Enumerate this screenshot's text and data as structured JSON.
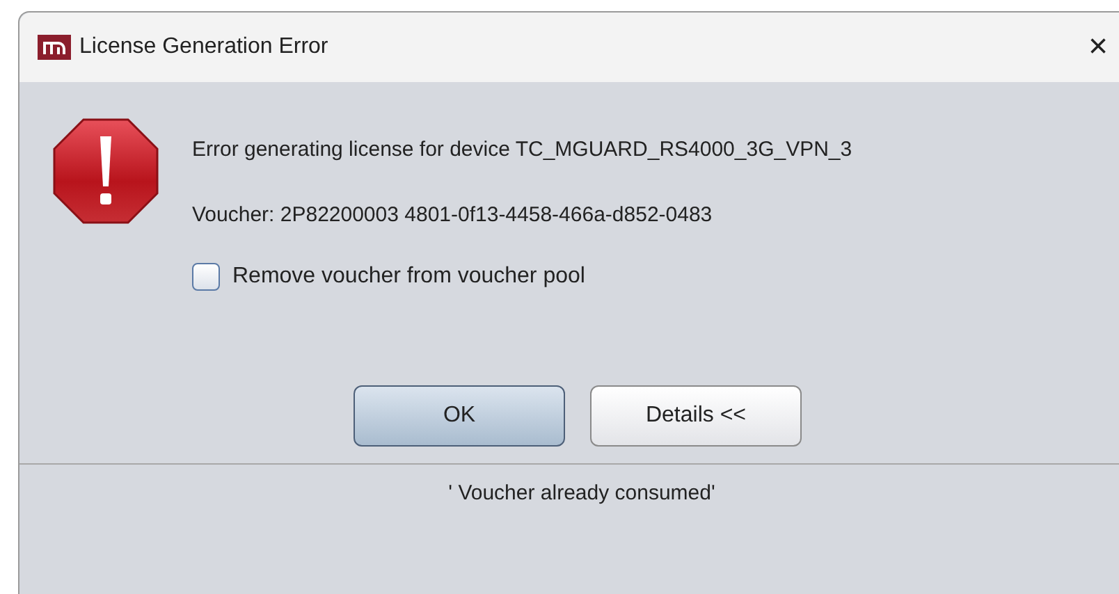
{
  "window": {
    "title": "License Generation Error",
    "close": "×"
  },
  "message": "Error generating license for device TC_MGUARD_RS4000_3G_VPN_3",
  "voucher": "Voucher: 2P82200003 4801-0f13-4458-466a-d852-0483",
  "checkbox": {
    "label": "Remove voucher from voucher pool",
    "checked": false
  },
  "buttons": [
    {
      "label": "OK",
      "selected": true
    },
    {
      "label": "Details <<",
      "selected": false
    }
  ],
  "details": "' Voucher already consumed'"
}
